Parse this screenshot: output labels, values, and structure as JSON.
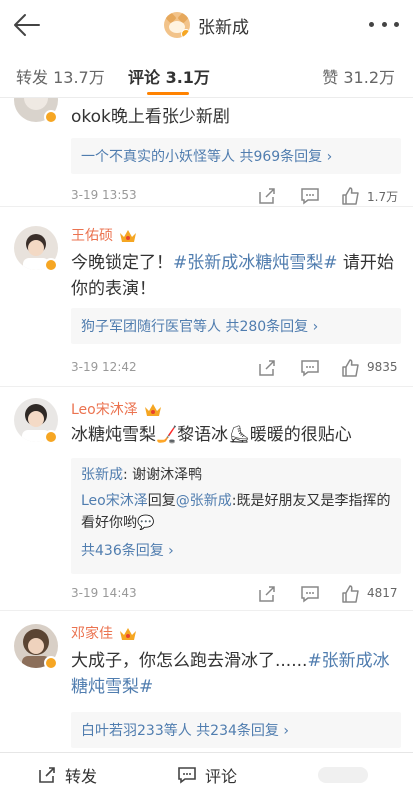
{
  "header": {
    "title": "张新成"
  },
  "tabs": {
    "repost": "转发 13.7万",
    "comment": "评论 3.1万",
    "like": "赞 31.2万"
  },
  "comments": [
    {
      "text": "okok晚上看张少新剧",
      "reply_link": "一个不真实的小妖怪等人 共969条回复 ›",
      "date": "3-19 13:53",
      "likes": "1.7万"
    },
    {
      "name": "王佑硕",
      "text_a": "今晚锁定了！",
      "tag": "#张新成冰糖炖雪梨#",
      "text_b": " 请开始你的表演！",
      "reply_link": "狗子军团随行医官等人 共280条回复 ›",
      "date": "3-19 12:42",
      "likes": "9835"
    },
    {
      "name": "Leo宋沐泽",
      "text": "冰糖炖雪梨🏒黎语冰⛸暖暖的很贴心",
      "reply1_user": "张新成",
      "reply1_text": ": 谢谢沐泽鸭",
      "reply2_user": "Leo宋沐泽",
      "reply2_mid": "回复",
      "reply2_at": "@张新成",
      "reply2_text": ":既是好朋友又是李指挥的看好你哟💬",
      "reply_link": "共436条回复 ›",
      "date": "3-19 14:43",
      "likes": "4817"
    },
    {
      "name": "邓家佳",
      "text_a": "大成子，你怎么跑去滑冰了......",
      "tag": "#张新成冰糖炖雪梨#",
      "reply_link": "白叶若羽233等人 共234条回复 ›"
    }
  ],
  "bottom": {
    "repost": "转发",
    "comment": "评论"
  },
  "colors": {
    "accent": "#ff8200",
    "name": "#eb7350",
    "link": "#507daf",
    "badge": "#f6a623"
  }
}
